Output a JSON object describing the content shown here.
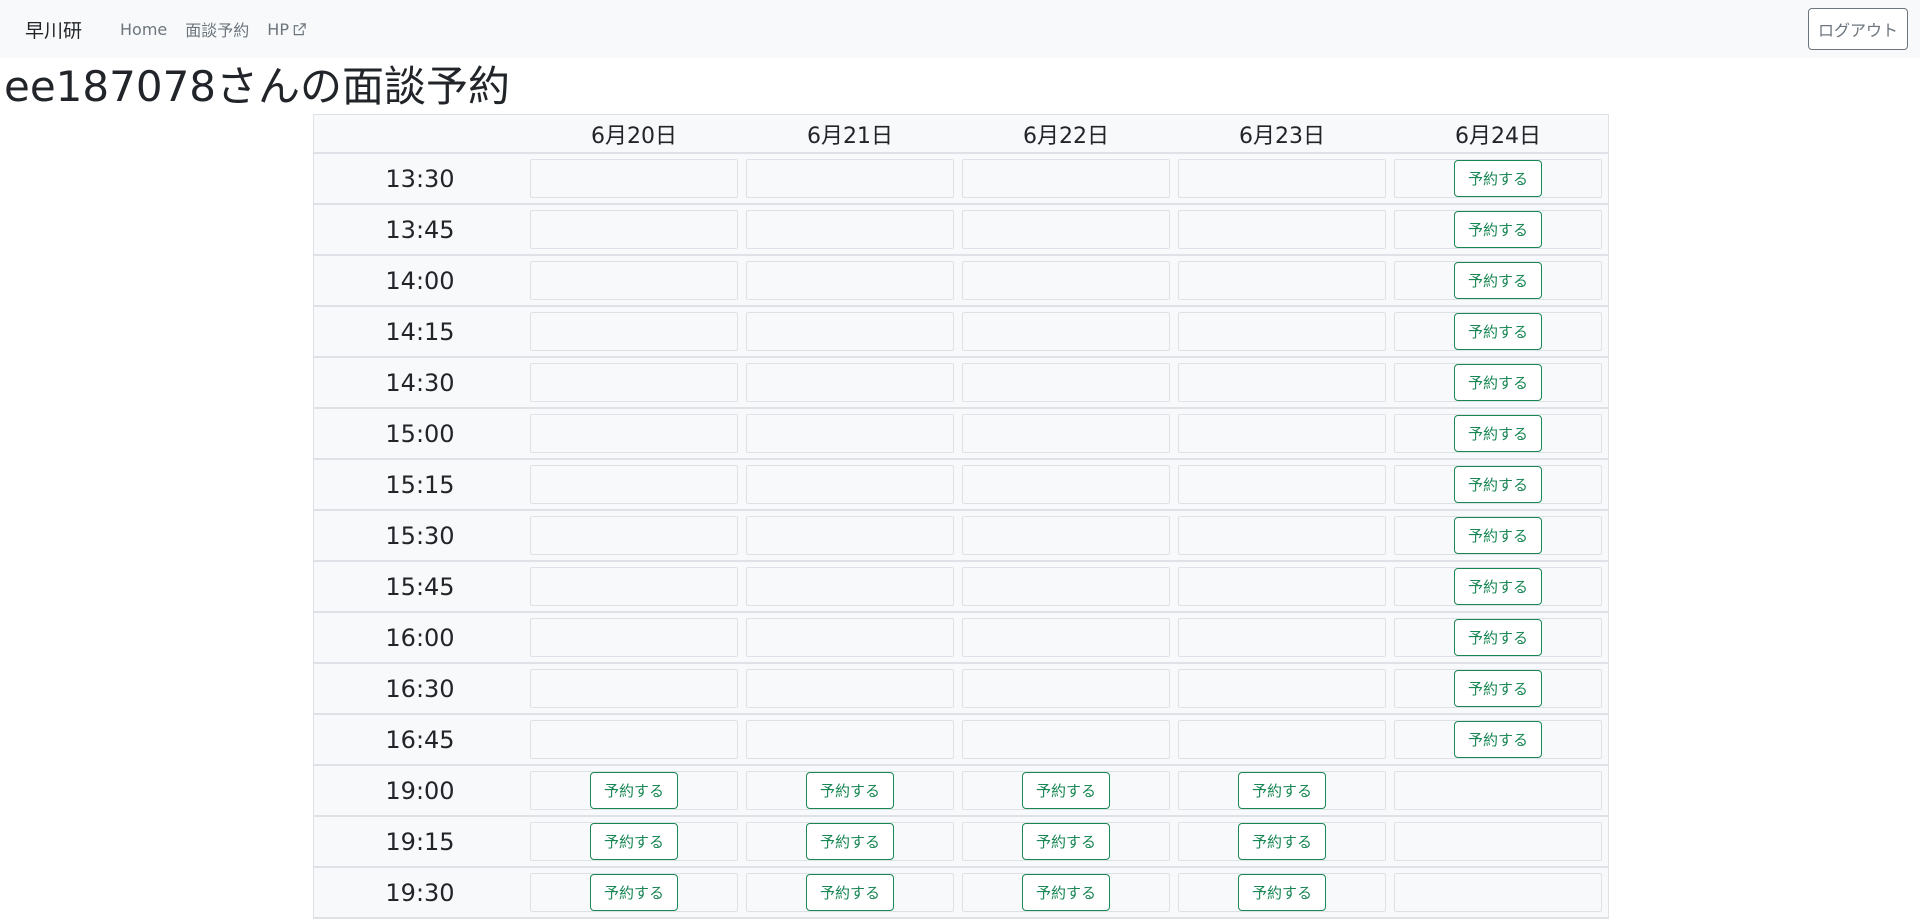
{
  "nav": {
    "brand": "早川研",
    "links": [
      "Home",
      "面談予約",
      "HP"
    ],
    "logout": "ログアウト"
  },
  "page": {
    "title": "ee187078さんの面談予約"
  },
  "schedule": {
    "dates": [
      "6月20日",
      "6月21日",
      "6月22日",
      "6月23日",
      "6月24日"
    ],
    "reserve_label": "予約する",
    "rows": [
      {
        "time": "13:30",
        "slots": [
          false,
          false,
          false,
          false,
          true
        ]
      },
      {
        "time": "13:45",
        "slots": [
          false,
          false,
          false,
          false,
          true
        ]
      },
      {
        "time": "14:00",
        "slots": [
          false,
          false,
          false,
          false,
          true
        ]
      },
      {
        "time": "14:15",
        "slots": [
          false,
          false,
          false,
          false,
          true
        ]
      },
      {
        "time": "14:30",
        "slots": [
          false,
          false,
          false,
          false,
          true
        ]
      },
      {
        "time": "15:00",
        "slots": [
          false,
          false,
          false,
          false,
          true
        ]
      },
      {
        "time": "15:15",
        "slots": [
          false,
          false,
          false,
          false,
          true
        ]
      },
      {
        "time": "15:30",
        "slots": [
          false,
          false,
          false,
          false,
          true
        ]
      },
      {
        "time": "15:45",
        "slots": [
          false,
          false,
          false,
          false,
          true
        ]
      },
      {
        "time": "16:00",
        "slots": [
          false,
          false,
          false,
          false,
          true
        ]
      },
      {
        "time": "16:30",
        "slots": [
          false,
          false,
          false,
          false,
          true
        ]
      },
      {
        "time": "16:45",
        "slots": [
          false,
          false,
          false,
          false,
          true
        ]
      },
      {
        "time": "19:00",
        "slots": [
          true,
          true,
          true,
          true,
          false
        ]
      },
      {
        "time": "19:15",
        "slots": [
          true,
          true,
          true,
          true,
          false
        ]
      },
      {
        "time": "19:30",
        "slots": [
          true,
          true,
          true,
          true,
          false
        ]
      }
    ]
  },
  "colors": {
    "accent": "#198754",
    "navbar_bg": "#f8f9fa",
    "muted": "#6c757d"
  },
  "icons": {
    "hp_link": "external-link-icon"
  }
}
